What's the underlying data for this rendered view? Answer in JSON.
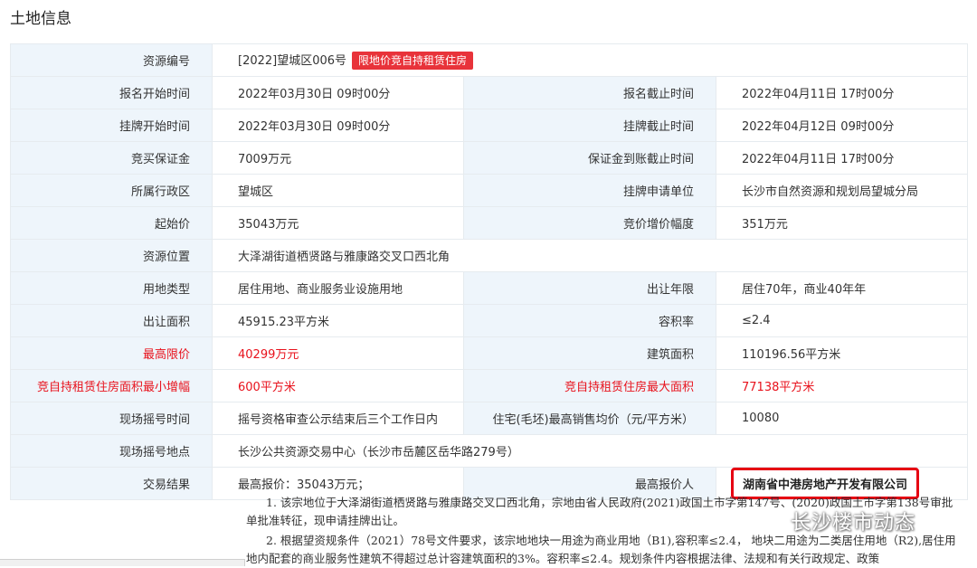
{
  "page_title": "土地信息",
  "rows": [
    {
      "l1": "资源编号",
      "v1": "[2022]望城区006号",
      "tag": "限地价竞自持租赁住房",
      "l2": "",
      "v2": ""
    },
    {
      "l1": "报名开始时间",
      "v1": "2022年03月30日 09时00分",
      "l2": "报名截止时间",
      "v2": "2022年04月11日 17时00分"
    },
    {
      "l1": "挂牌开始时间",
      "v1": "2022年03月30日 09时00分",
      "l2": "挂牌截止时间",
      "v2": "2022年04月12日 09时00分"
    },
    {
      "l1": "竞买保证金",
      "v1": "7009万元",
      "l2": "保证金到账截止时间",
      "v2": "2022年04月11日 17时00分"
    },
    {
      "l1": "所属行政区",
      "v1": "望城区",
      "l2": "挂牌申请单位",
      "v2": "长沙市自然资源和规划局望城分局"
    },
    {
      "l1": "起始价",
      "v1": "35043万元",
      "l2": "竞价增价幅度",
      "v2": "351万元"
    },
    {
      "l1": "资源位置",
      "v1": "大泽湖街道栖贤路与雅康路交叉口西北角",
      "l2": "",
      "v2": ""
    },
    {
      "l1": "用地类型",
      "v1": "居住用地、商业服务业设施用地",
      "l2": "出让年限",
      "v2": "居住70年，商业40年年"
    },
    {
      "l1": "出让面积",
      "v1": "45915.23平方米",
      "l2": "容积率",
      "v2": "≤2.4"
    },
    {
      "l1": "最高限价",
      "v1": "40299万元",
      "l2": "建筑面积",
      "v2": "110196.56平方米"
    },
    {
      "l1": "竞自持租赁住房面积最小增幅",
      "v1": "600平方米",
      "l2": "竞自持租赁住房最大面积",
      "v2": "77138平方米"
    },
    {
      "l1": "现场摇号时间",
      "v1": "摇号资格审查公示结束后三个工作日内",
      "l2": "住宅(毛坯)最高销售均价（元/平方米）",
      "v2": "10080"
    },
    {
      "l1": "现场摇号地点",
      "v1": "长沙公共资源交易中心（长沙市岳麓区岳华路279号）",
      "l2": "",
      "v2": ""
    },
    {
      "l1": "交易结果",
      "v1": "最高报价：35043万元；",
      "l2": "最高报价人",
      "v2": "湖南省中港房地产开发有限公司"
    }
  ],
  "notes": [
    "1. 该宗地位于大泽湖街道栖贤路与雅康路交叉口西北角，宗地由省人民政府(2021)政国土市字第147号、(2020)政国土市字第138号审批单批准转征，现申请挂牌出让。",
    "2. 根据望资规条件（2021）78号文件要求，该宗地地块一用途为商业用地（B1),容积率≤2.4， 地块二用途为二类居住用地（R2),居住用地内配套的商业服务性建筑不得超过总计容建筑面积的3%。容积率≤2.4。规划条件内容根据法律、法规和有关行政规定、政策"
  ],
  "watermark": "长沙楼市动态",
  "colors": {
    "label_bg": "#eef5fb",
    "border": "#e6ebef",
    "red": "#e8121c",
    "tag_bg": "#e8333a",
    "highlight": "#e60012"
  }
}
